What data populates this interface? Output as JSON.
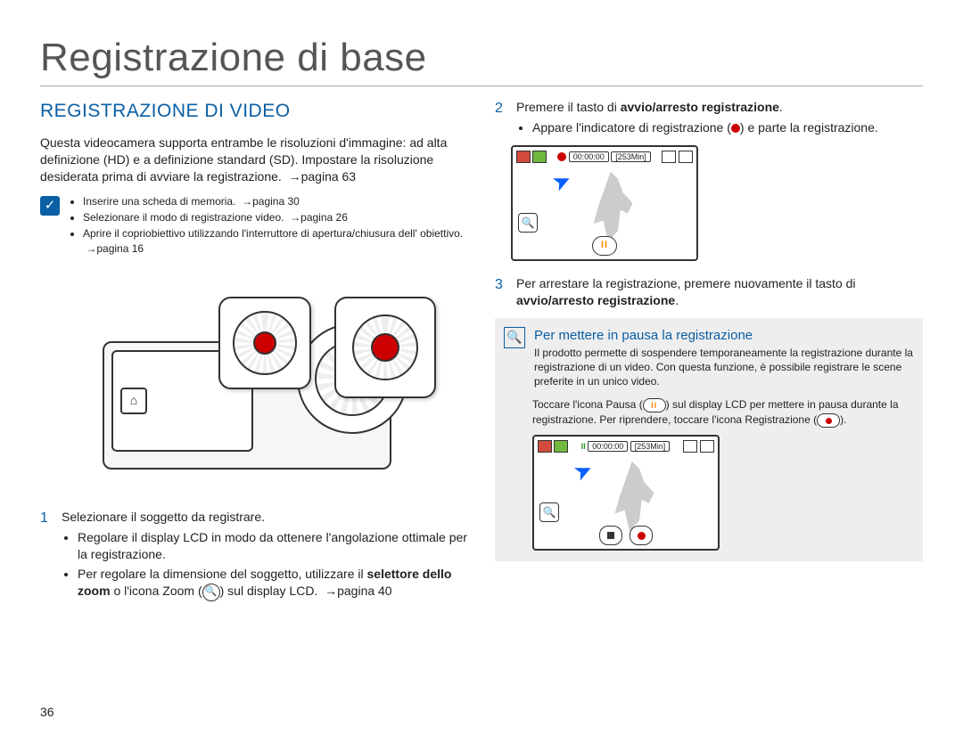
{
  "page_number": "36",
  "chapter_title": "Registrazione di base",
  "section_title": "REGISTRAZIONE DI VIDEO",
  "intro": "Questa videocamera supporta entrambe le risoluzioni d'immagine: ad alta definizione (HD) e a definizione standard (SD). Impostare la risoluzione desiderata prima di avviare la registrazione.",
  "intro_ref": "pagina 63",
  "preconditions": [
    {
      "text": "Inserire una scheda di memoria.",
      "ref": "pagina 30"
    },
    {
      "text": "Selezionare il modo di registrazione video.",
      "ref": "pagina 26"
    },
    {
      "text": "Aprire il copriobiettivo utilizzando l'interruttore di apertura/chiusura dell' obiettivo.",
      "ref": "pagina 16"
    }
  ],
  "step1": {
    "num": "1",
    "title": "Selezionare il soggetto da registrare.",
    "bullets": [
      {
        "text": "Regolare il display LCD in modo da ottenere l'angolazione ottimale per la registrazione."
      },
      {
        "text_before": "Per regolare la dimensione del soggetto, utilizzare il ",
        "bold1": "selettore dello zoom",
        "mid": " o l'icona Zoom (",
        "after_icon": ") sul display LCD.",
        "ref": "pagina 40"
      }
    ]
  },
  "step2": {
    "num": "2",
    "title_before": "Premere il tasto di ",
    "title_bold": "avvio/arresto registrazione",
    "title_after": ".",
    "bullet_before": "Appare l'indicatore di registrazione (",
    "bullet_after": ") e parte la registrazione."
  },
  "step3": {
    "num": "3",
    "title_before": "Per arrestare la registrazione, premere nuovamente il tasto di ",
    "title_bold": "avvio/arresto registrazione",
    "title_after": "."
  },
  "lcd1": {
    "time": "00:00:00",
    "remain": "[253Min]"
  },
  "lcd2": {
    "time": "00:00:00",
    "remain": "[253Min]"
  },
  "tip": {
    "title": "Per mettere in pausa la registrazione",
    "body": "Il prodotto permette di sospendere temporaneamente la registrazione durante la registrazione di un video. Con questa funzione, è possibile registrare le scene preferite in un unico video.",
    "sub_before": "Toccare l'icona Pausa (",
    "sub_mid": ") sul display LCD per mettere in pausa durante la registrazione. Per riprendere, toccare l'icona Registrazione (",
    "sub_after": ")."
  }
}
